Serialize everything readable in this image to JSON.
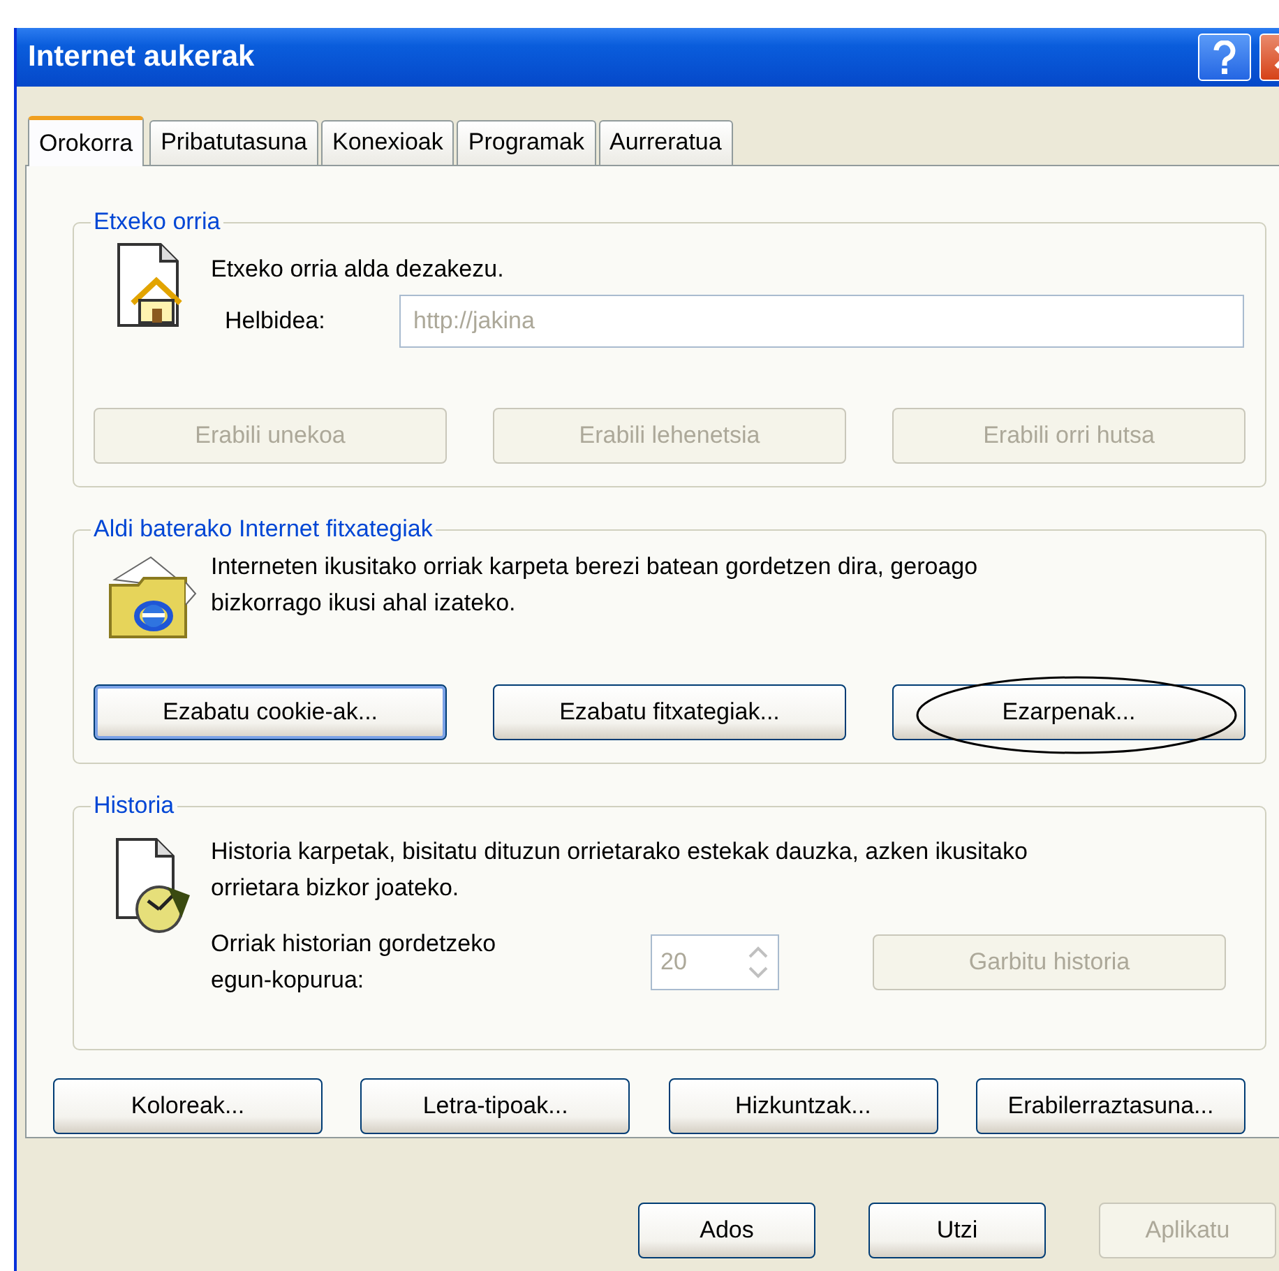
{
  "window": {
    "title": "Internet aukerak"
  },
  "tabs": [
    {
      "label": "Orokorra",
      "selected": true
    },
    {
      "label": "Pribatutasuna",
      "selected": false
    },
    {
      "label": "Konexioak",
      "selected": false
    },
    {
      "label": "Programak",
      "selected": false
    },
    {
      "label": "Aurreratua",
      "selected": false
    }
  ],
  "home_page": {
    "title": "Etxeko orria",
    "description": "Etxeko orria alda dezakezu.",
    "address_label": "Helbidea:",
    "address": {
      "value": "http://jakina",
      "disabled": true
    },
    "buttons": [
      {
        "label": "Erabili unekoa",
        "disabled": true,
        "focused": false
      },
      {
        "label": "Erabili lehenetsia",
        "disabled": true,
        "focused": false
      },
      {
        "label": "Erabili orri hutsa",
        "disabled": true,
        "focused": false
      }
    ]
  },
  "temporary_files": {
    "title": "Aldi baterako Internet fitxategiak",
    "description": "Interneten ikusitako orriak karpeta berezi batean gordetzen dira, geroago bizkorrago ikusi ahal izateko.",
    "buttons": [
      {
        "label": "Ezabatu cookie-ak...",
        "disabled": false,
        "focused": true
      },
      {
        "label": "Ezabatu fitxategiak...",
        "disabled": false,
        "focused": false
      },
      {
        "label": "Ezarpenak...",
        "disabled": false,
        "focused": false
      }
    ]
  },
  "history": {
    "title": "Historia",
    "description": "Historia karpetak, bisitatu dituzun orrietarako estekak dauzka, azken ikusitako orrietara bizkor joateko.",
    "days_label": "Orriak historian gordetzeko egun-kopurua:",
    "days": {
      "value": "20",
      "disabled": true
    },
    "clear_button": {
      "label": "Garbitu historia",
      "disabled": true,
      "focused": false
    }
  },
  "bottom_buttons": [
    {
      "label": "Koloreak...",
      "disabled": false,
      "focused": false
    },
    {
      "label": "Letra-tipoak...",
      "disabled": false,
      "focused": false
    },
    {
      "label": "Hizkuntzak...",
      "disabled": false,
      "focused": false
    },
    {
      "label": "Erabilerraztasuna...",
      "disabled": false,
      "focused": false
    }
  ],
  "dialog_buttons": [
    {
      "label": "Ados",
      "disabled": false,
      "focused": false
    },
    {
      "label": "Utzi",
      "disabled": false,
      "focused": false
    },
    {
      "label": "Aplikatu",
      "disabled": true,
      "focused": false
    }
  ]
}
